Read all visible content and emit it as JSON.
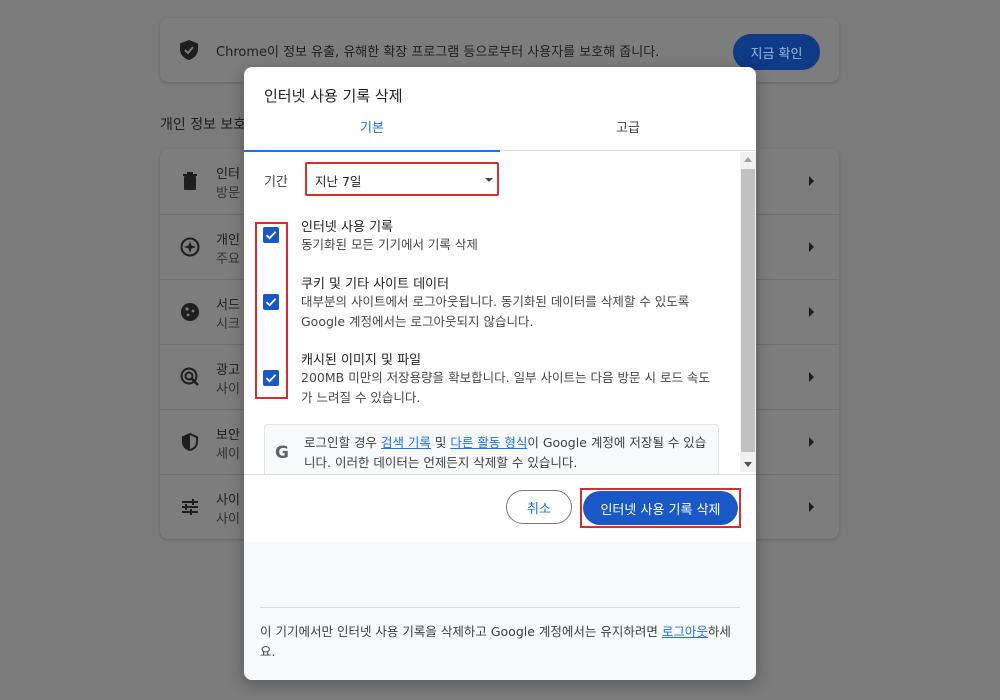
{
  "background": {
    "safety_check": {
      "text": "Chrome이 정보 유출, 유해한 확장 프로그램 등으로부터 사용자를 보호해 줍니다.",
      "button": "지금 확인"
    },
    "section_title": "개인 정보 보호",
    "rows": [
      {
        "icon": "trash-icon",
        "line1": "인터",
        "line2": "방문"
      },
      {
        "icon": "privacy-guide-icon",
        "line1": "개인",
        "line2": "주요"
      },
      {
        "icon": "cookie-icon",
        "line1": "서드",
        "line2": "시크"
      },
      {
        "icon": "ad-privacy-icon",
        "line1": "광고",
        "line2": "사이"
      },
      {
        "icon": "shield-icon",
        "line1": "보안",
        "line2": "세이"
      },
      {
        "icon": "tune-icon",
        "line1": "사이",
        "line2": "사이"
      }
    ]
  },
  "dialog": {
    "title": "인터넷 사용 기록 삭제",
    "tabs": {
      "basic": "기본",
      "advanced": "고급"
    },
    "period": {
      "label": "기간",
      "value": "지난 7일"
    },
    "options": [
      {
        "title": "인터넷 사용 기록",
        "desc": "동기화된 모든 기기에서 기록 삭제",
        "checked": true
      },
      {
        "title": "쿠키 및 기타 사이트 데이터",
        "desc": "대부분의 사이트에서 로그아웃됩니다. 동기화된 데이터를 삭제할 수 있도록 Google 계정에서는 로그아웃되지 않습니다.",
        "checked": true
      },
      {
        "title": "캐시된 이미지 및 파일",
        "desc": "200MB 미만의 저장용량을 확보합니다. 일부 사이트는 다음 방문 시 로드 속도가 느려질 수 있습니다.",
        "checked": true
      }
    ],
    "google_notice": {
      "logo": "G",
      "before": "로그인할 경우 ",
      "link1": "검색 기록",
      "mid": " 및 ",
      "link2": "다른 활동 형식",
      "after": "이 Google 계정에 저장될 수 있습니다. 이러한 데이터는 언제든지 삭제할 수 있습니다."
    },
    "buttons": {
      "cancel": "취소",
      "delete": "인터넷 사용 기록 삭제"
    },
    "signout_note": {
      "before": "이 기기에서만 인터넷 사용 기록을 삭제하고 Google 계정에서는 유지하려면 ",
      "link": "로그아웃",
      "after": "하세요."
    }
  },
  "colors": {
    "accent": "#1a73e8",
    "checkbox": "#1a58c8",
    "highlight": "#d32f2f"
  }
}
